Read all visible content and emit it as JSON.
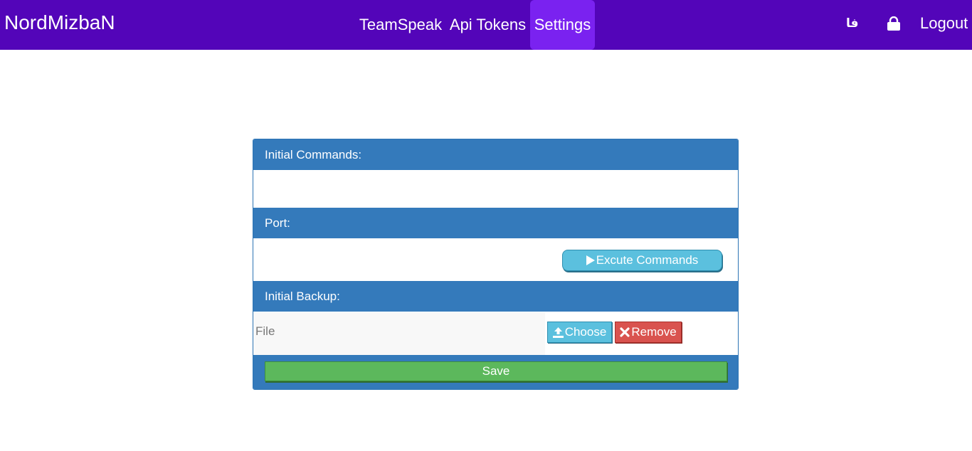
{
  "navbar": {
    "brand": "NordMizbaN",
    "items": [
      {
        "label": "TeamSpeak",
        "active": false
      },
      {
        "label": "Api Tokens",
        "active": false
      },
      {
        "label": "Settings",
        "active": true
      }
    ],
    "language": "فا",
    "lock_icon": "lock-icon",
    "logout_label": "Logout"
  },
  "panel": {
    "initial_commands_label": "Initial Commands:",
    "port_label": "Port:",
    "execute_button": "Excute Commands",
    "execute_icon": "play-icon",
    "initial_backup_label": "Initial Backup:",
    "file_placeholder": "File",
    "choose_button": "Choose",
    "choose_icon": "upload-icon",
    "remove_button": "Remove",
    "remove_icon": "close-icon",
    "save_button": "Save"
  },
  "colors": {
    "navbar_bg": "#5305b9",
    "nav_active_bg": "#7a22f0",
    "panel_header": "#347abb",
    "info_button": "#5bc0de",
    "danger_button": "#d9534f",
    "success_button": "#5cb85c"
  }
}
